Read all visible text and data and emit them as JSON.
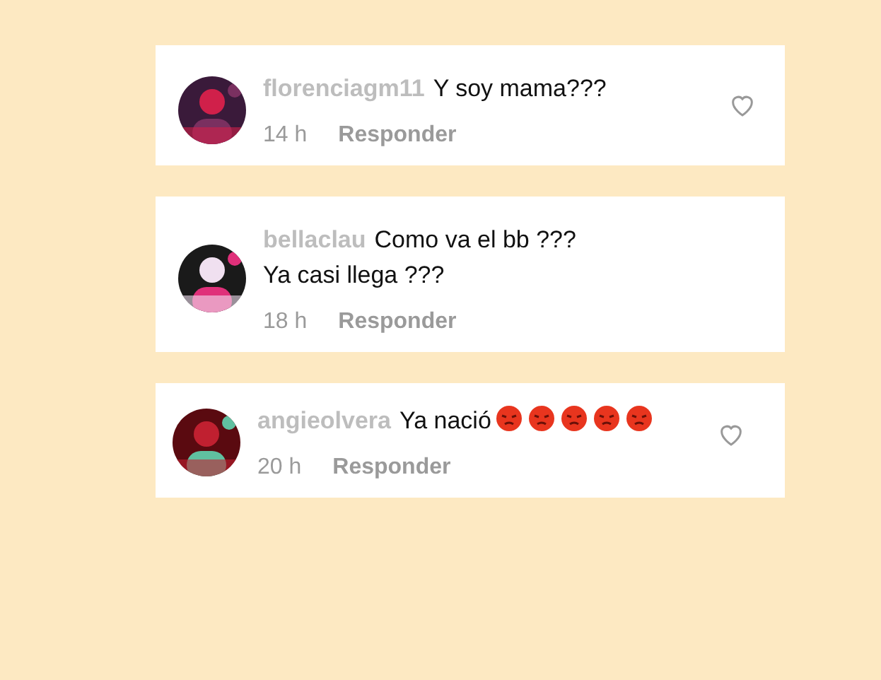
{
  "comments": [
    {
      "username": "florenciagm11",
      "text": "Y soy mama???",
      "time": "14 h",
      "reply": "Responder",
      "heart": true
    },
    {
      "username": "bellaclau",
      "text": "Como va el bb ??? Ya casi llega ???",
      "time": "18 h",
      "reply": "Responder",
      "heart": false
    },
    {
      "username": "angieolvera",
      "text": "Ya nació",
      "time": "20 h",
      "reply": "Responder",
      "heart": true,
      "emojis": [
        {
          "kind": "face"
        },
        {
          "kind": "face"
        },
        {
          "kind": "face"
        },
        {
          "kind": "face"
        },
        {
          "kind": "face"
        }
      ]
    }
  ]
}
